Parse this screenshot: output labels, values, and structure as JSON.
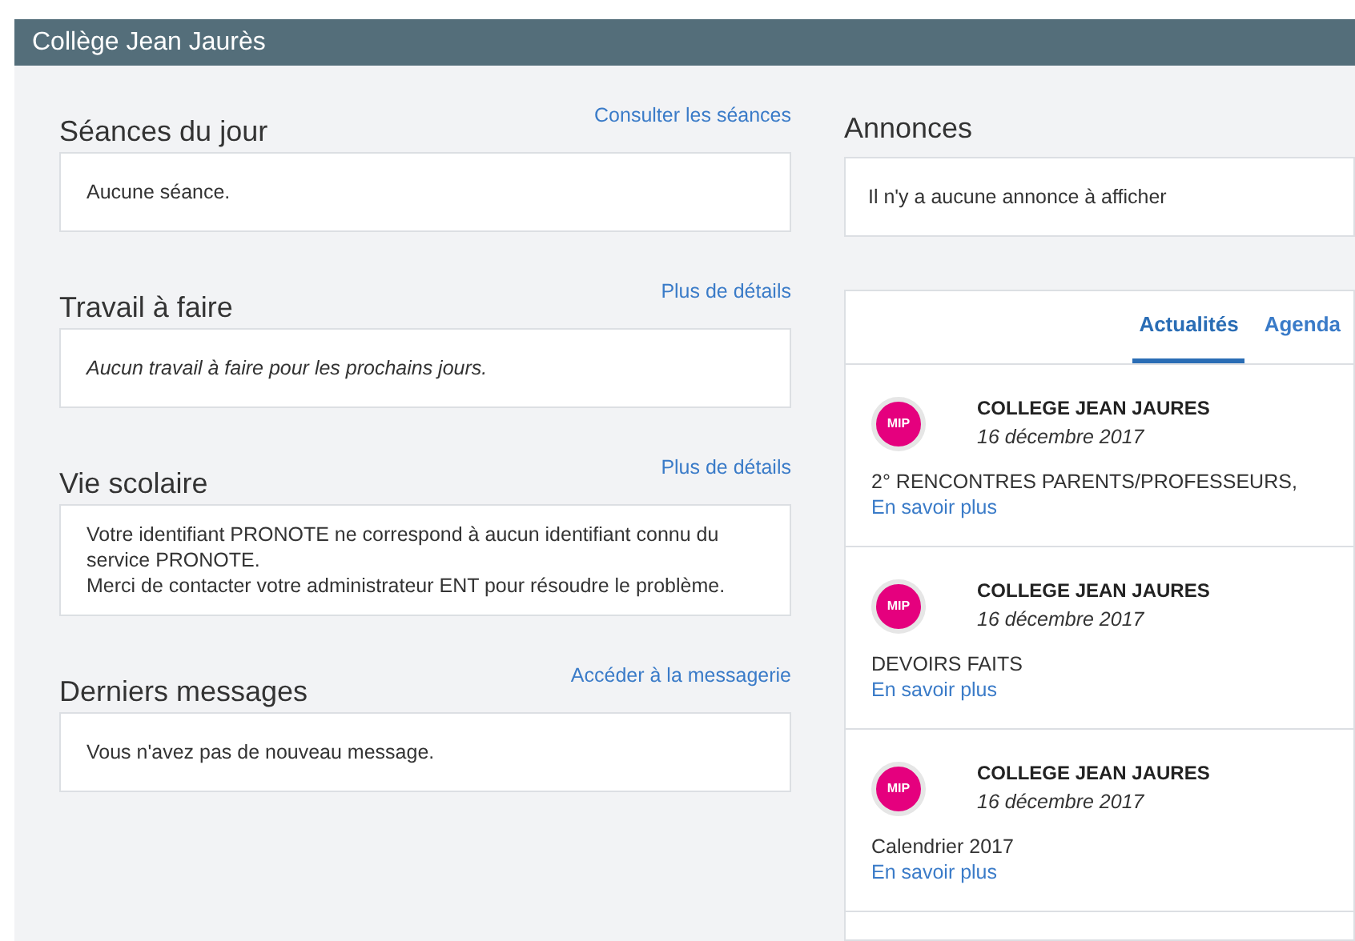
{
  "header": {
    "title": "Collège Jean Jaurès"
  },
  "left_sections": [
    {
      "title": "Séances du jour",
      "link": "Consulter les séances",
      "kind": "plain",
      "lines": [
        "Aucune séance."
      ]
    },
    {
      "title": "Travail à faire",
      "link": "Plus de détails",
      "kind": "italic",
      "lines": [
        "Aucun travail à faire pour les prochains jours."
      ]
    },
    {
      "title": "Vie scolaire",
      "link": "Plus de détails",
      "kind": "plain",
      "lines": [
        "Votre identifiant PRONOTE ne correspond à aucun identifiant connu du service PRONOTE.",
        "Merci de contacter votre administrateur ENT pour résoudre le problème."
      ]
    },
    {
      "title": "Derniers messages",
      "link": "Accéder à la messagerie",
      "kind": "plain",
      "lines": [
        "Vous n'avez pas de nouveau message."
      ]
    }
  ],
  "announcements": {
    "title": "Annonces",
    "body": "Il n'y a aucune annonce à afficher"
  },
  "news_panel": {
    "tabs": [
      {
        "label": "Actualités",
        "selected": true
      },
      {
        "label": "Agenda",
        "selected": false
      }
    ],
    "items": [
      {
        "avatar": "MIP",
        "author": "COLLEGE JEAN JAURES",
        "date": "16 décembre 2017",
        "text": "2° RENCONTRES PARENTS/PROFESSEURS,",
        "link": "En savoir plus"
      },
      {
        "avatar": "MIP",
        "author": "COLLEGE JEAN JAURES",
        "date": "16 décembre 2017",
        "text": "DEVOIRS FAITS",
        "link": "En savoir plus"
      },
      {
        "avatar": "MIP",
        "author": "COLLEGE JEAN JAURES",
        "date": "16 décembre 2017",
        "text": "Calendrier 2017",
        "link": "En savoir plus"
      }
    ]
  }
}
